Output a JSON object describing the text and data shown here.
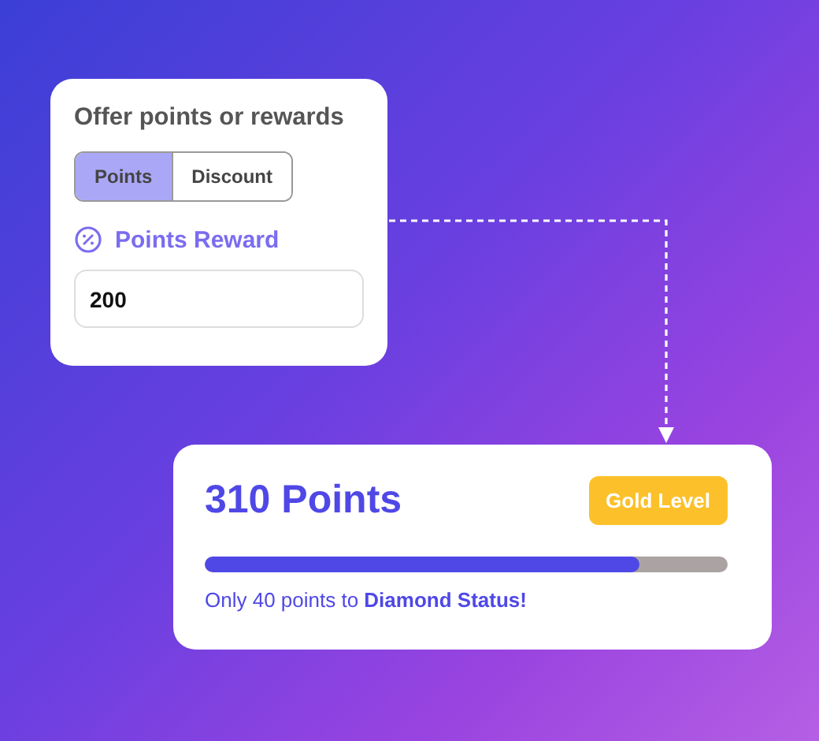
{
  "offer_card": {
    "title": "Offer points or rewards",
    "tabs": [
      {
        "label": "Points",
        "selected": true
      },
      {
        "label": "Discount",
        "selected": false
      }
    ],
    "reward_label": "Points Reward",
    "reward_field": {
      "value": "200"
    }
  },
  "status_card": {
    "points": "310 Points",
    "badge": "Gold Level",
    "progress": {
      "level": 0.83
    },
    "message": "Only 40 points to **Diamond Status!**"
  }
}
